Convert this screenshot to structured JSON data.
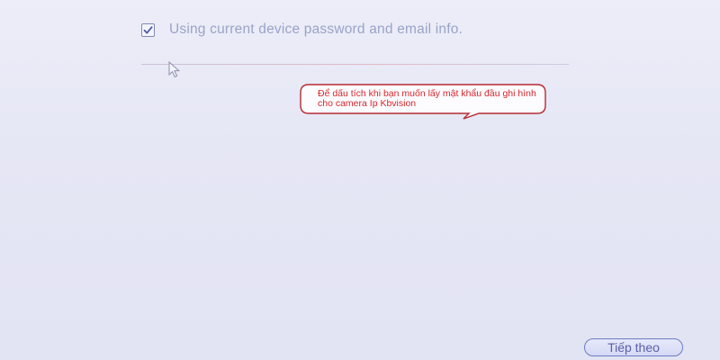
{
  "options": {
    "use_current_device_password": {
      "label": "Using current device password and email info.",
      "checked": true
    }
  },
  "annotation": {
    "text": "Để dấu tích khi bạn muốn lấy mật khẩu đầu ghi hình cho camera Ip Kbvision"
  },
  "footer": {
    "next_label": "Tiếp theo"
  },
  "icons": {
    "checkbox": "checkmark-icon",
    "cursor": "mouse-pointer-icon"
  },
  "colors": {
    "annotation_text": "#d8262c",
    "annotation_border": "#b62a30",
    "button_border": "#6d7cc4",
    "label_text": "#9aa3c8"
  }
}
